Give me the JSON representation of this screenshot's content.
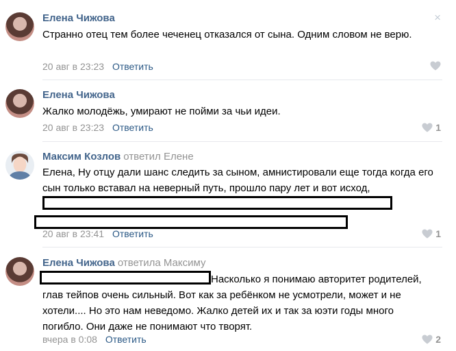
{
  "comments": [
    {
      "author": "Елена Чижова",
      "reply_to": "",
      "text": "Странно отец тем более чеченец отказался от сына. Одним словом не верю.",
      "date": "20 авг в 23:23",
      "reply_label": "Ответить",
      "likes": ""
    },
    {
      "author": "Елена Чижова",
      "reply_to": "",
      "text": "Жалко молодёжь, умирают не пойми за чьи идеи.",
      "date": "20 авг в 23:23",
      "reply_label": "Ответить",
      "likes": "1"
    },
    {
      "author": "Максим Козлов",
      "reply_to": "ответил Елене",
      "text_before": "Елена, Ну отцу дали шанс следить за сыном, амнистировали еще тогда когда его сын только вставал на неверный путь, прошло пару лет и вот исход,",
      "date": "20 авг в 23:41",
      "reply_label": "Ответить",
      "likes": "1"
    },
    {
      "author": "Елена Чижова",
      "reply_to": "ответила Максиму",
      "text_after": "Насколько я понимаю авторитет родителей, глав тейпов очень сильный. Вот как за ребёнком не усмотрели, может и не хотели.... Но это нам неведомо. Жалко детей их и так за юэти годы много погибло. Они даже не понимают что творят.",
      "date": "вчера в 0:08",
      "reply_label": "Ответить",
      "likes": "2"
    }
  ],
  "close_icon": "×"
}
